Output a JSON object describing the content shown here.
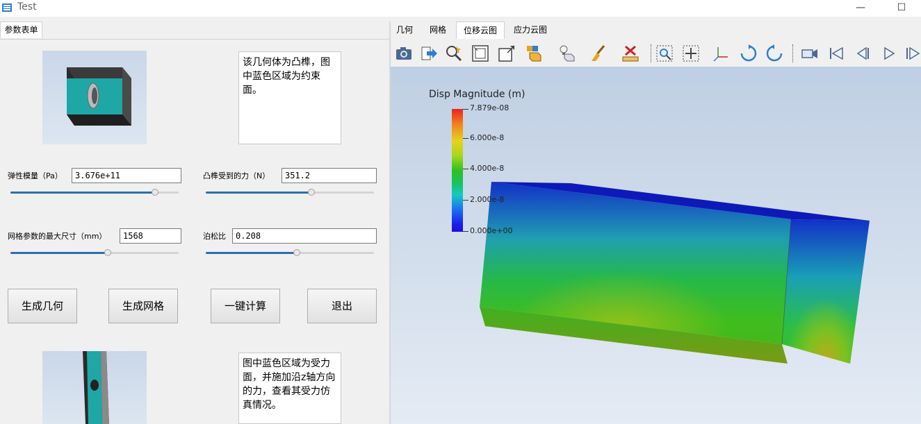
{
  "window": {
    "title": "Test",
    "minimize": "—",
    "maximize": "☐"
  },
  "left": {
    "tab": "参数表单",
    "desc1": "该几何体为凸榫，图中蓝色区域为约束面。",
    "desc2": "图中蓝色区域为受力面，并施加沿z轴方向的力，查看其受力仿真情况。",
    "params": {
      "elastic_label": "弹性模量（Pa）",
      "elastic_value": "3.676e+11",
      "elastic_slider": 0.86,
      "force_label": "凸榫受到的力（N）",
      "force_value": "351.2",
      "force_slider": 0.63,
      "mesh_label": "网格参数的最大尺寸（mm）",
      "mesh_value": "1568",
      "mesh_slider": 0.58,
      "poisson_label": "泊松比",
      "poisson_value": "0.208",
      "poisson_slider": 0.54
    },
    "buttons": {
      "gen_geometry": "生成几何",
      "gen_mesh": "生成网格",
      "compute": "一键计算",
      "exit": "退出"
    }
  },
  "right": {
    "tabs": [
      "几何",
      "网格",
      "位移云图",
      "应力云图"
    ],
    "active_tab": 2,
    "toolbar_icons": [
      "camera-icon",
      "export-icon",
      "magic-select-icon",
      "fit-frame-icon",
      "zoom-box-icon",
      "color-cube-icon",
      "light-cube-icon",
      "brush-icon",
      "ruler-delete-icon",
      "zoom-select-icon",
      "pan-icon",
      "axes-icon",
      "rotate-cw-icon",
      "rotate-ccw-icon",
      "video-icon",
      "first-frame-icon",
      "prev-frame-icon",
      "play-icon",
      "last-frame-icon"
    ],
    "legend": {
      "title": "Disp Magnitude (m)",
      "ticks": [
        "7.879e-08",
        "6.000e-8",
        "4.000e-8",
        "2.000e-8",
        "0.000e+00"
      ]
    }
  },
  "colors": {
    "accent": "#2a6fb0",
    "viewport_top": "#bfcfe3",
    "viewport_bottom": "#e4ebf4"
  }
}
